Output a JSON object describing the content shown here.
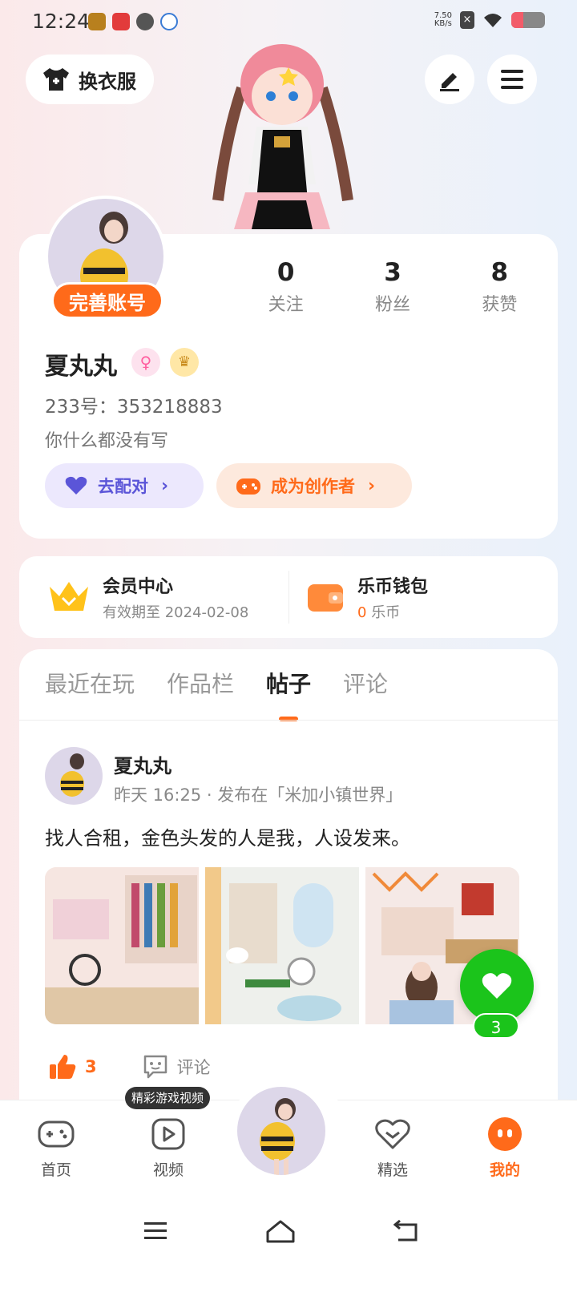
{
  "status_bar": {
    "time": "12:24",
    "net_speed_value": "7.50",
    "net_speed_unit": "KB/s",
    "battery_level": 0.35
  },
  "header": {
    "outfit_label": "换衣服"
  },
  "profile": {
    "complete_label": "完善账号",
    "stats": [
      {
        "value": "0",
        "label": "关注"
      },
      {
        "value": "3",
        "label": "粉丝"
      },
      {
        "value": "8",
        "label": "获赞"
      }
    ],
    "name": "夏丸丸",
    "uid": "233号：353218883",
    "bio": "你什么都没有写",
    "match_label": "去配对",
    "creator_label": "成为创作者"
  },
  "vip": {
    "member_title": "会员中心",
    "member_sub": "有效期至 2024-02-08",
    "wallet_title": "乐币钱包",
    "wallet_amount": "0",
    "wallet_unit": "乐币"
  },
  "tabs": [
    "最近在玩",
    "作品栏",
    "帖子",
    "评论"
  ],
  "post": {
    "author": "夏丸丸",
    "meta": "昨天 16:25 · 发布在「米加小镇世界」",
    "text": "找人合租，金色头发的人是我，人设发来。",
    "like_count": "3",
    "comment_label": "评论"
  },
  "float_heart_count": "3",
  "bottom_nav": {
    "items": [
      {
        "label": "首页"
      },
      {
        "label": "视频"
      },
      {
        "label": "精选"
      },
      {
        "label": "我的"
      }
    ],
    "video_tip": "精彩游戏视频"
  },
  "colors": {
    "accent": "#ff6a1a",
    "green": "#1bc41b",
    "purple": "#5b55d8"
  }
}
